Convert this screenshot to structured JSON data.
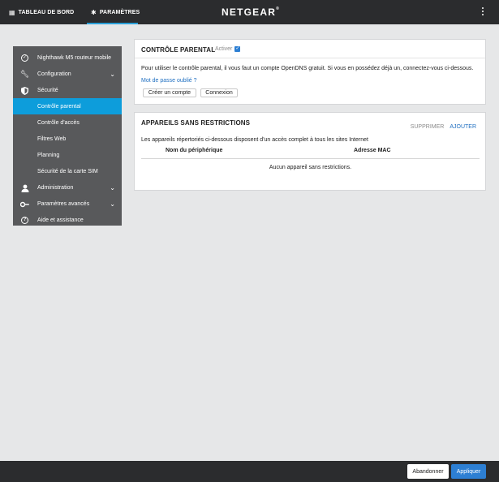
{
  "topbar": {
    "tabs": [
      {
        "label": "TABLEAU DE BORD",
        "icon": "dashboard-icon"
      },
      {
        "label": "PARAMÈTRES",
        "icon": "gear-icon",
        "active": true
      }
    ],
    "logo": "NETGEAR",
    "logo_mark": "®",
    "accent": "#2a9fd8"
  },
  "sidebar": {
    "items": [
      {
        "label": "Nighthawk M5 routeur mobile",
        "icon": "check-circle-icon"
      },
      {
        "label": "Configuration",
        "icon": "wrench-icon",
        "chevron": "⌄"
      },
      {
        "label": "Sécurité",
        "icon": "shield-icon"
      },
      {
        "label": "Contrôle parental",
        "active": true
      },
      {
        "label": "Contrôle d'accès"
      },
      {
        "label": "Filtres Web"
      },
      {
        "label": "Planning"
      },
      {
        "label": "Sécurité de la carte SIM"
      },
      {
        "label": "Administration",
        "icon": "person-icon",
        "chevron": "⌄"
      },
      {
        "label": "Paramètres avancés",
        "icon": "key-icon",
        "chevron": "⌄"
      },
      {
        "label": "Aide et assistance",
        "icon": "help-icon"
      }
    ],
    "active_color": "#0d9ddb"
  },
  "parental": {
    "title": "CONTRÔLE PARENTAL",
    "enable_label": "Activer",
    "enabled": true,
    "description": "Pour utiliser le contrôle parental, il vous faut un compte OpenDNS gratuit. Si vous en possédez déjà un, connectez-vous ci-dessous.",
    "forgot_link": "Mot de passe oublié ?",
    "create_button": "Créer un compte",
    "login_button": "Connexion"
  },
  "unrestricted": {
    "title": "APPAREILS SANS RESTRICTIONS",
    "delete_label": "SUPPRIMER",
    "add_label": "AJOUTER",
    "description": "Les appareils répertoriés ci-dessous disposent d'un accès complet à tous les sites Internet",
    "columns": [
      "Nom du périphérique",
      "Adresse MAC"
    ],
    "empty_text": "Aucun appareil sans restrictions."
  },
  "footer": {
    "cancel_button": "Abandonner",
    "apply_button": "Appliquer"
  }
}
